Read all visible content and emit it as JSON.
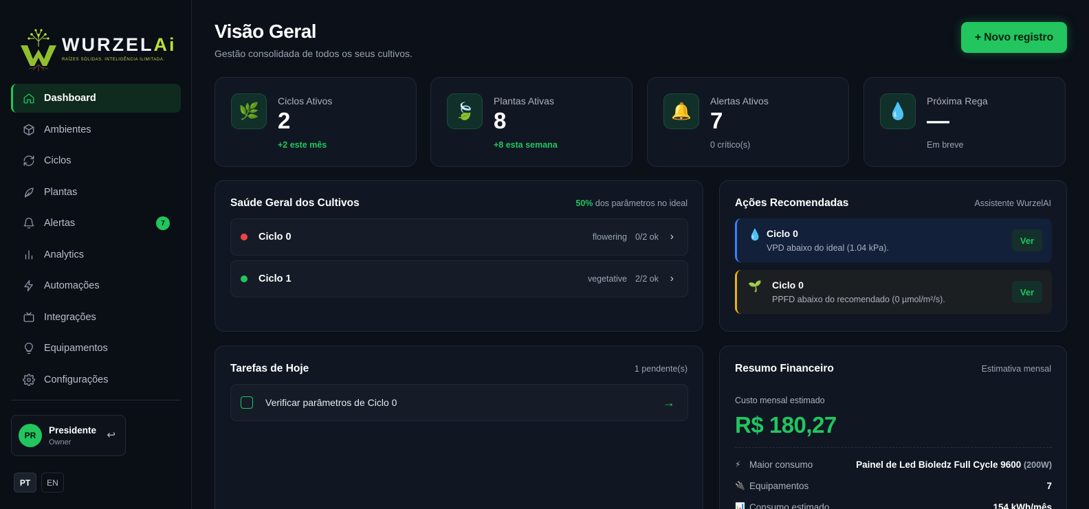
{
  "brand": {
    "name_main": "WURZEL",
    "name_accent": "Ai",
    "tagline": "RAÍZES SÓLIDAS. INTELIGÊNCIA ILIMITADA."
  },
  "sidebar": {
    "items": [
      {
        "label": "Dashboard",
        "icon": "home-icon",
        "active": true
      },
      {
        "label": "Ambientes",
        "icon": "cube-icon"
      },
      {
        "label": "Ciclos",
        "icon": "refresh-icon"
      },
      {
        "label": "Plantas",
        "icon": "leaf-icon"
      },
      {
        "label": "Alertas",
        "icon": "bell-icon",
        "badge": "7"
      },
      {
        "label": "Analytics",
        "icon": "bar-chart-icon"
      },
      {
        "label": "Automações",
        "icon": "lightning-icon"
      },
      {
        "label": "Integrações",
        "icon": "tv-icon"
      },
      {
        "label": "Equipamentos",
        "icon": "lightbulb-icon"
      },
      {
        "label": "Configurações",
        "icon": "gear-icon"
      }
    ],
    "user": {
      "initials": "PR",
      "name": "Presidente",
      "role": "Owner",
      "logout_icon": "↩"
    },
    "languages": [
      "PT",
      "EN"
    ],
    "active_language": "PT"
  },
  "header": {
    "title": "Visão Geral",
    "subtitle": "Gestão consolidada de todos os seus cultivos.",
    "new_button": "+ Novo registro"
  },
  "stats": [
    {
      "label": "Ciclos Ativos",
      "value": "2",
      "note": "+2 este mês",
      "note_green": true,
      "icon": "🌿"
    },
    {
      "label": "Plantas Ativas",
      "value": "8",
      "note": "+8 esta semana",
      "note_green": true,
      "icon": "🍃"
    },
    {
      "label": "Alertas Ativos",
      "value": "7",
      "note": "0 crítico(s)",
      "note_green": false,
      "icon": "🔔"
    },
    {
      "label": "Próxima Rega",
      "value": "—",
      "note": "Em breve",
      "note_green": false,
      "icon": "💧"
    }
  ],
  "health": {
    "title": "Saúde Geral dos Cultivos",
    "percent": "50%",
    "percent_suffix": "dos parâmetros no ideal",
    "cycles": [
      {
        "name": "Ciclo 0",
        "stage": "flowering",
        "status": "0/2 ok",
        "color": "#ef4444"
      },
      {
        "name": "Ciclo 1",
        "stage": "vegetative",
        "status": "2/2 ok",
        "color": "#22c55e"
      }
    ]
  },
  "actions": {
    "title": "Ações Recomendadas",
    "subtitle": "Assistente WurzelAI",
    "items": [
      {
        "title": "Ciclo 0",
        "desc": "VPD abaixo do ideal (1.04 kPa).",
        "button": "Ver",
        "icon": "💧"
      },
      {
        "title": "Ciclo 0",
        "desc": "PPFD abaixo do recomendado (0 µmol/m²/s).",
        "button": "Ver",
        "icon": "🌱"
      }
    ]
  },
  "tasks": {
    "title": "Tarefas de Hoje",
    "count": "1 pendente(s)",
    "items": [
      {
        "text": "Verificar parâmetros de Ciclo 0",
        "arrow": "→"
      }
    ]
  },
  "finance": {
    "title": "Resumo Financeiro",
    "subtitle": "Estimativa mensal",
    "cost_label": "Custo mensal estimado",
    "cost_value": "R$ 180,27",
    "rows": [
      {
        "icon": "⚡",
        "label": "Maior consumo",
        "value": "Painel de Led Bioledz Full Cycle 9600",
        "extra": "(200W)"
      },
      {
        "icon": "🔌",
        "label": "Equipamentos",
        "value": "7",
        "extra": ""
      },
      {
        "icon": "📊",
        "label": "Consumo estimado",
        "value": "154 kWh/mês",
        "extra": ""
      }
    ]
  },
  "colors": {
    "accent": "#22c55e",
    "background": "#0b1019",
    "card": "#101723"
  }
}
